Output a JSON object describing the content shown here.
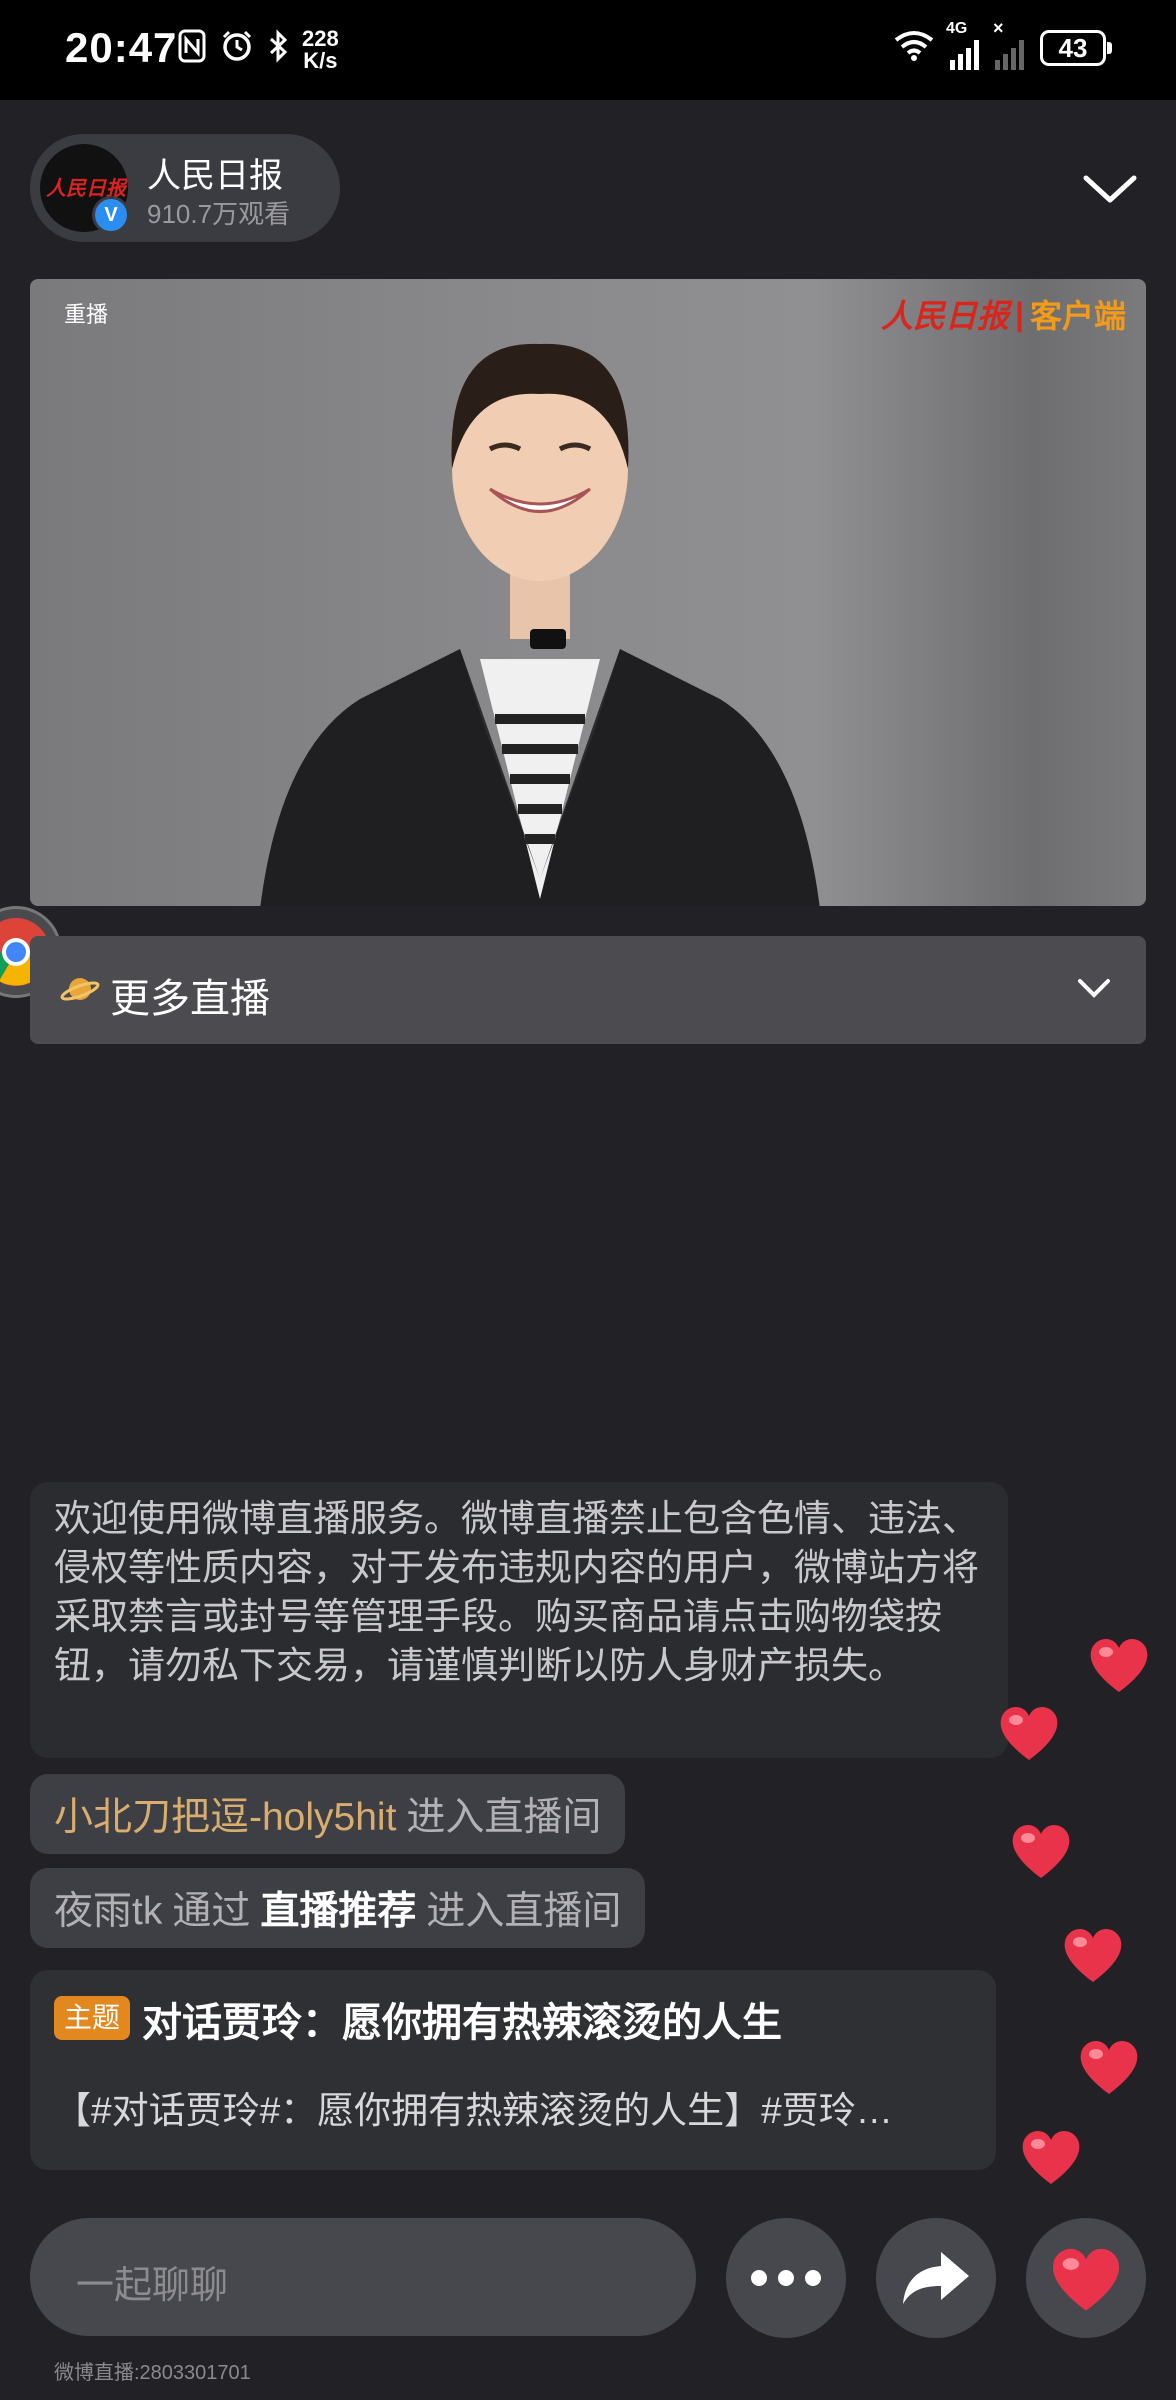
{
  "status_bar": {
    "time": "20:47",
    "speed_value": "228",
    "speed_unit": "K/s",
    "network": "4G",
    "battery": "43"
  },
  "host": {
    "name": "人民日报",
    "views": "910.7万观看",
    "avatar_text": "人民日报",
    "verified_mark": "V"
  },
  "video": {
    "replay_tag": "重播",
    "brand_cn": "人民日报",
    "brand_sep": "|",
    "brand_client": "客户端"
  },
  "more_live": {
    "label": "更多直播"
  },
  "notice": {
    "text": "欢迎使用微博直播服务。微博直播禁止包含色情、违法、侵权等性质内容，对于发布违规内容的用户，微博站方将采取禁言或封号等管理手段。购买商品请点击购物袋按钮，请勿私下交易，请谨慎判断以防人身财产损失。"
  },
  "messages": [
    {
      "user": "小北刀把逗-holy5hit",
      "action": "进入直播间"
    },
    {
      "user": "夜雨tk",
      "via": "通过",
      "source": "直播推荐",
      "action": "进入直播间"
    }
  ],
  "topic": {
    "badge": "主题",
    "title": "对话贾玲：愿你拥有热辣滚烫的人生",
    "desc": "【#对话贾玲#：愿你拥有热辣滚烫的人生】#贾玲…"
  },
  "chat": {
    "placeholder": "一起聊聊"
  },
  "footer": {
    "id_text": "微博直播:2803301701"
  },
  "colors": {
    "background": "#222226",
    "accent_gold": "#d8ad6e",
    "topic_orange": "#e3881f",
    "heart_red": "#e8334a"
  }
}
